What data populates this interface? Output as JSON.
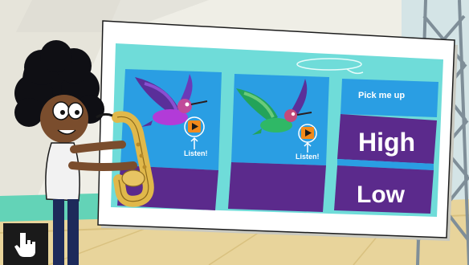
{
  "board": {
    "panel1": {
      "listen_label": "Listen!"
    },
    "panel2": {
      "listen_label": "Listen!"
    },
    "panel3": {
      "prompt": "Pick me up",
      "option_high": "High",
      "option_low": "Low"
    }
  },
  "icons": {
    "play": "play-icon",
    "arrow_up": "arrow-up-icon",
    "pointer": "hand-pointer-icon"
  },
  "colors": {
    "board_teal": "#6fdcd9",
    "panel_blue": "#2a9ee3",
    "panel_purple": "#5b2a8c",
    "play_orange": "#f28a1c"
  }
}
